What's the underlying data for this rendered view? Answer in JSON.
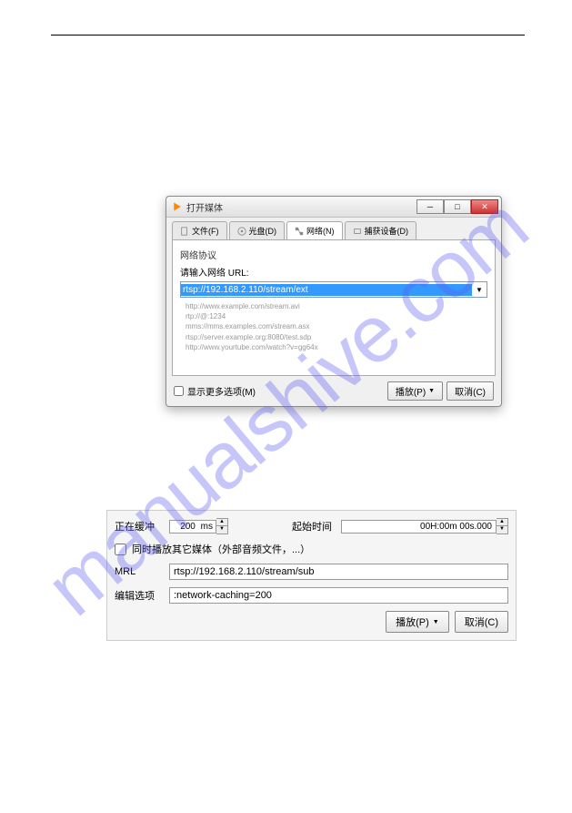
{
  "watermark": "manualshive.com",
  "dialog": {
    "title": "打开媒体",
    "tabs": {
      "file": "文件(F)",
      "disc": "光盘(D)",
      "network": "网络(N)",
      "capture": "捕获设备(D)"
    },
    "network": {
      "group_title": "网络协议",
      "url_label": "请输入网络 URL:",
      "url_value": "rtsp://192.168.2.110/stream/ext",
      "examples": {
        "e1": "http://www.example.com/stream.avi",
        "e2": "rtp://@:1234",
        "e3": "mms://mms.examples.com/stream.asx",
        "e4": "rtsp://server.example.org:8080/test.sdp",
        "e5": "http://www.yourtube.com/watch?v=gg64x"
      }
    },
    "more_options": "显示更多选项(M)",
    "play_btn": "播放(P)",
    "cancel_btn": "取消(C)"
  },
  "lower": {
    "caching_label": "正在缓冲",
    "caching_value": "200",
    "caching_unit": "ms",
    "start_time_label": "起始时间",
    "start_time_value": "00H:00m 00s.000",
    "sync_label": "同时播放其它媒体（外部音频文件，...）",
    "mrl_label": "MRL",
    "mrl_value": "rtsp://192.168.2.110/stream/sub",
    "edit_opts_label": "编辑选项",
    "edit_opts_value": ":network-caching=200",
    "play_btn": "播放(P)",
    "cancel_btn": "取消(C)"
  }
}
